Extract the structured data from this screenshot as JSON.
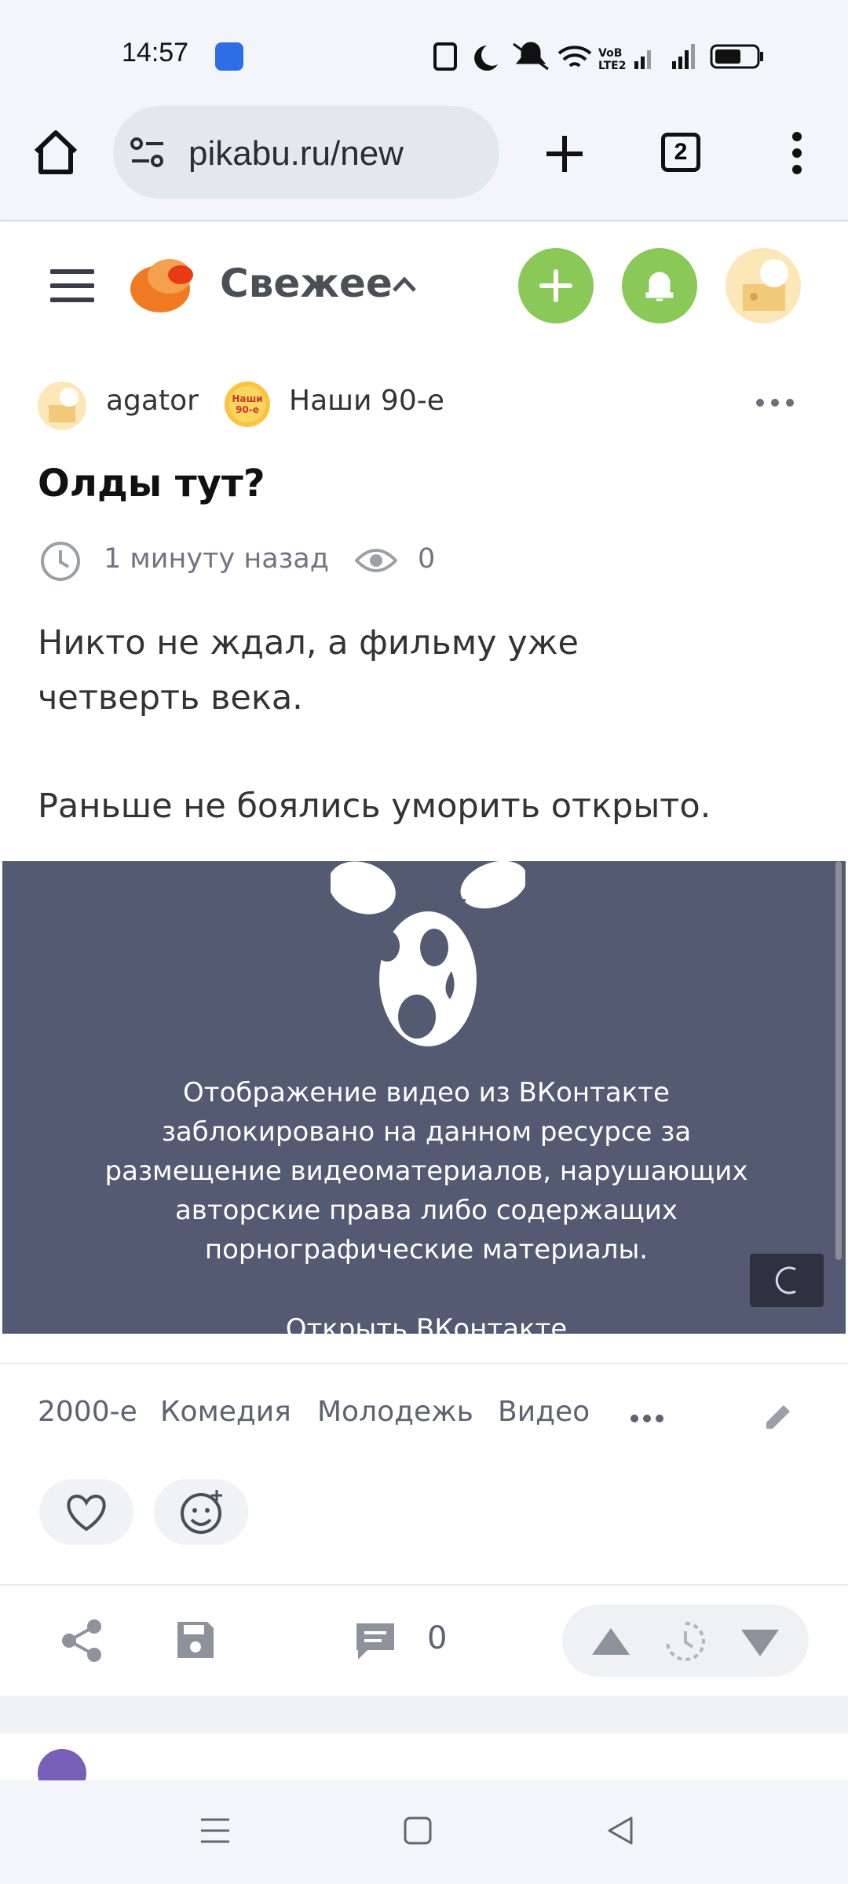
{
  "status_bar": {
    "time": "14:57"
  },
  "browser": {
    "url": "pikabu.ru/new",
    "tab_count": "2"
  },
  "header": {
    "feed_title": "Свежее"
  },
  "post": {
    "author": "agator",
    "community": "Наши 90-е",
    "community_badge": "Наши 90-е",
    "title": "Олды тут?",
    "time": "1 минуту назад",
    "views": "0",
    "text_line1": "Никто не ждал, а фильму уже",
    "text_line2": "четверть века.",
    "text_line3": "Раньше не боялись уморить открыто.",
    "video_message": "Отображение видео из ВКонтакте заблокировано на данном ресурсе за размещение видеоматериалов, нарушающих авторские права либо содержащих порнографические материалы.",
    "video_open_link": "Открыть ВКонтакте",
    "tags": [
      "2000-е",
      "Комедия",
      "Молодежь",
      "Видео"
    ],
    "comments": "0"
  },
  "colors": {
    "accent_green": "#8ac858",
    "video_bg": "#535a71"
  }
}
